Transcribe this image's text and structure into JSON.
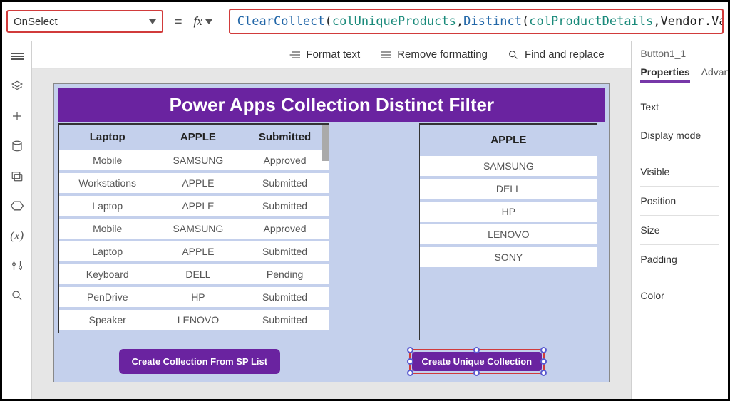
{
  "property_selector": {
    "value": "OnSelect"
  },
  "formula": {
    "parts": [
      {
        "text": "ClearCollect",
        "cls": "fn-blue"
      },
      {
        "text": "(",
        "cls": "fn-black"
      },
      {
        "text": "colUniqueProducts",
        "cls": "fn-teal"
      },
      {
        "text": ",",
        "cls": "fn-black"
      },
      {
        "text": "Distinct",
        "cls": "fn-blue"
      },
      {
        "text": "(",
        "cls": "fn-black"
      },
      {
        "text": "colProductDetails",
        "cls": "fn-teal"
      },
      {
        "text": ",Vendor.Value))",
        "cls": "fn-black"
      }
    ]
  },
  "toolbar": {
    "format_text": "Format text",
    "remove_formatting": "Remove formatting",
    "find_replace": "Find and replace"
  },
  "canvas": {
    "title": "Power Apps Collection Distinct Filter",
    "left_table": {
      "headers": [
        "Laptop",
        "APPLE",
        "Submitted"
      ],
      "rows": [
        [
          "Mobile",
          "SAMSUNG",
          "Approved"
        ],
        [
          "Workstations",
          "APPLE",
          "Submitted"
        ],
        [
          "Laptop",
          "APPLE",
          "Submitted"
        ],
        [
          "Mobile",
          "SAMSUNG",
          "Approved"
        ],
        [
          "Laptop",
          "APPLE",
          "Submitted"
        ],
        [
          "Keyboard",
          "DELL",
          "Pending"
        ],
        [
          "PenDrive",
          "HP",
          "Submitted"
        ],
        [
          "Speaker",
          "LENOVO",
          "Submitted"
        ]
      ]
    },
    "right_table": {
      "rows": [
        "APPLE",
        "SAMSUNG",
        "DELL",
        "HP",
        "LENOVO",
        "SONY"
      ]
    },
    "button_left": "Create Collection From SP List",
    "button_right": "Create Unique Collection"
  },
  "right_panel": {
    "control_name": "Button1_1",
    "tabs": {
      "properties": "Properties",
      "advanced": "Advance"
    },
    "props": [
      "Text",
      "Display mode",
      "Visible",
      "Position",
      "Size",
      "Padding",
      "Color"
    ]
  },
  "leftbar_icons": [
    "menu",
    "layers",
    "plus",
    "data",
    "media",
    "flow",
    "variables",
    "tools",
    "search"
  ]
}
